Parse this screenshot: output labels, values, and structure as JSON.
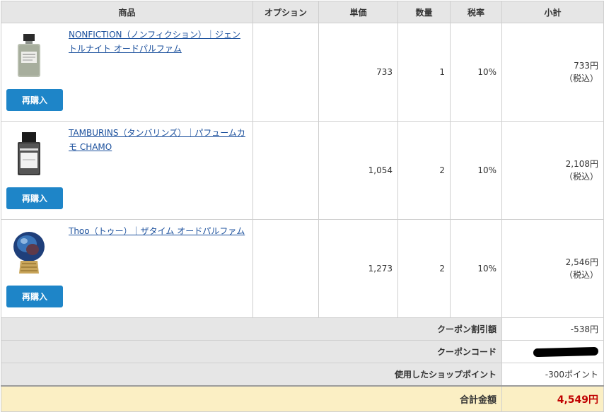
{
  "columns": {
    "product": "商品",
    "option": "オプション",
    "unit_price": "単価",
    "quantity": "数量",
    "tax_rate": "税率",
    "subtotal": "小計"
  },
  "items": [
    {
      "name": "NONFICTION（ノンフィクション）｜ジェントルナイト オードパルファム",
      "option": "",
      "unit_price": "733",
      "quantity": "1",
      "tax_rate": "10%",
      "subtotal": "733円",
      "tax_note": "（税込）",
      "rebuy_label": "再購入"
    },
    {
      "name": "TAMBURINS（タンバリンズ）｜パフュームカモ CHAMO",
      "option": "",
      "unit_price": "1,054",
      "quantity": "2",
      "tax_rate": "10%",
      "subtotal": "2,108円",
      "tax_note": "（税込）",
      "rebuy_label": "再購入"
    },
    {
      "name": "Thoo（トゥー）｜ザタイム オードパルファム",
      "option": "",
      "unit_price": "1,273",
      "quantity": "2",
      "tax_rate": "10%",
      "subtotal": "2,546円",
      "tax_note": "（税込）",
      "rebuy_label": "再購入"
    }
  ],
  "summary": {
    "coupon_discount_label": "クーポン割引額",
    "coupon_discount_value": "-538円",
    "coupon_code_label": "クーポンコード",
    "points_label": "使用したショップポイント",
    "points_value": "-300ポイント",
    "total_label": "合計金額",
    "total_value": "4,549円"
  },
  "colors": {
    "header_bg": "#e6e6e6",
    "button_blue": "#1e85c8",
    "link_blue": "#1a4f9c",
    "total_bg": "#fbefc4",
    "total_red": "#c00000"
  }
}
